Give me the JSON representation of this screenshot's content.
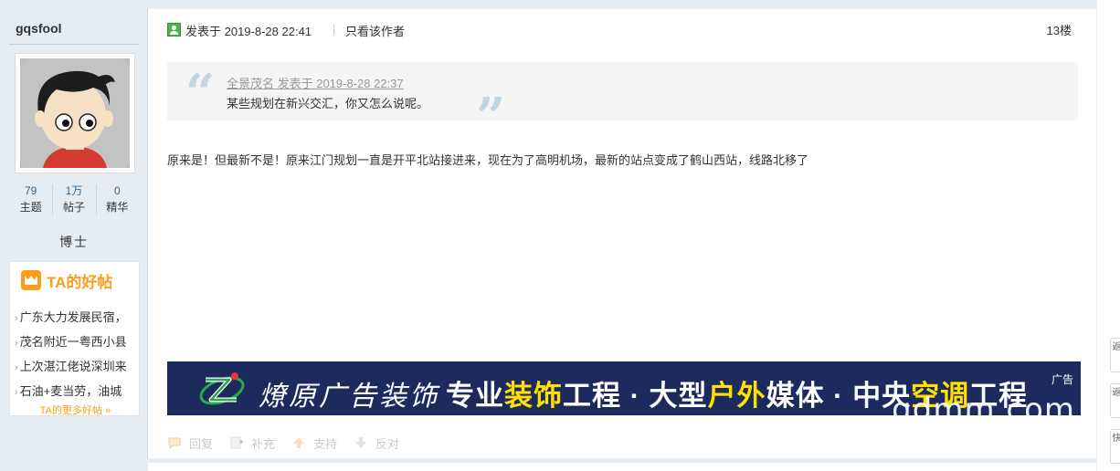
{
  "user": {
    "username": "gqsfool",
    "stats": [
      {
        "num": "79",
        "label": "主题"
      },
      {
        "num": "1万",
        "label": "帖子"
      },
      {
        "num": "0",
        "label": "精华"
      }
    ],
    "rank": "博士",
    "good_posts": {
      "title": "TA的好帖",
      "items": [
        "广东大力发展民宿，",
        "茂名附近一粤西小县",
        "上次湛江佬说深圳来",
        "石油+麦当劳，油城"
      ],
      "more": "TA的更多好帖 »"
    }
  },
  "post": {
    "posted_label": "发表于 2019-8-28 22:41",
    "pipe": "|",
    "only_author": "只看该作者",
    "floor": "13楼",
    "quote": {
      "open_mark": "“",
      "close_mark": "”",
      "meta": "全景茂名 发表于 2019-8-28 22:37",
      "text": "某些规划在新兴交汇，你又怎么说呢。"
    },
    "body": "原来是！但最新不是！原来江门规划一直是开平北站接进来，现在为了高明机场，最新的站点变成了鹤山西站，线路北移了"
  },
  "ad": {
    "brand": "燎原广告装饰",
    "slogan_parts": [
      "专业",
      "装饰",
      "工程 · 大型",
      "户外",
      "媒体 · 中央",
      "空调",
      "工程"
    ],
    "tag": "广告",
    "watermark": "gdmm.com"
  },
  "actions": [
    {
      "label": "回复",
      "icon": "reply-icon"
    },
    {
      "label": "补充",
      "icon": "supplement-icon"
    },
    {
      "label": "支持",
      "icon": "thumb-up-icon"
    },
    {
      "label": "反对",
      "icon": "thumb-down-icon"
    }
  ],
  "right_tools": [
    "返",
    "返",
    "快"
  ],
  "colors": {
    "sidebar_bg": "#e5edf2",
    "link_blue": "#336699",
    "orange": "#ff9c1a",
    "ad_bg": "#1c2a5e",
    "ad_highlight": "#ffe100"
  }
}
